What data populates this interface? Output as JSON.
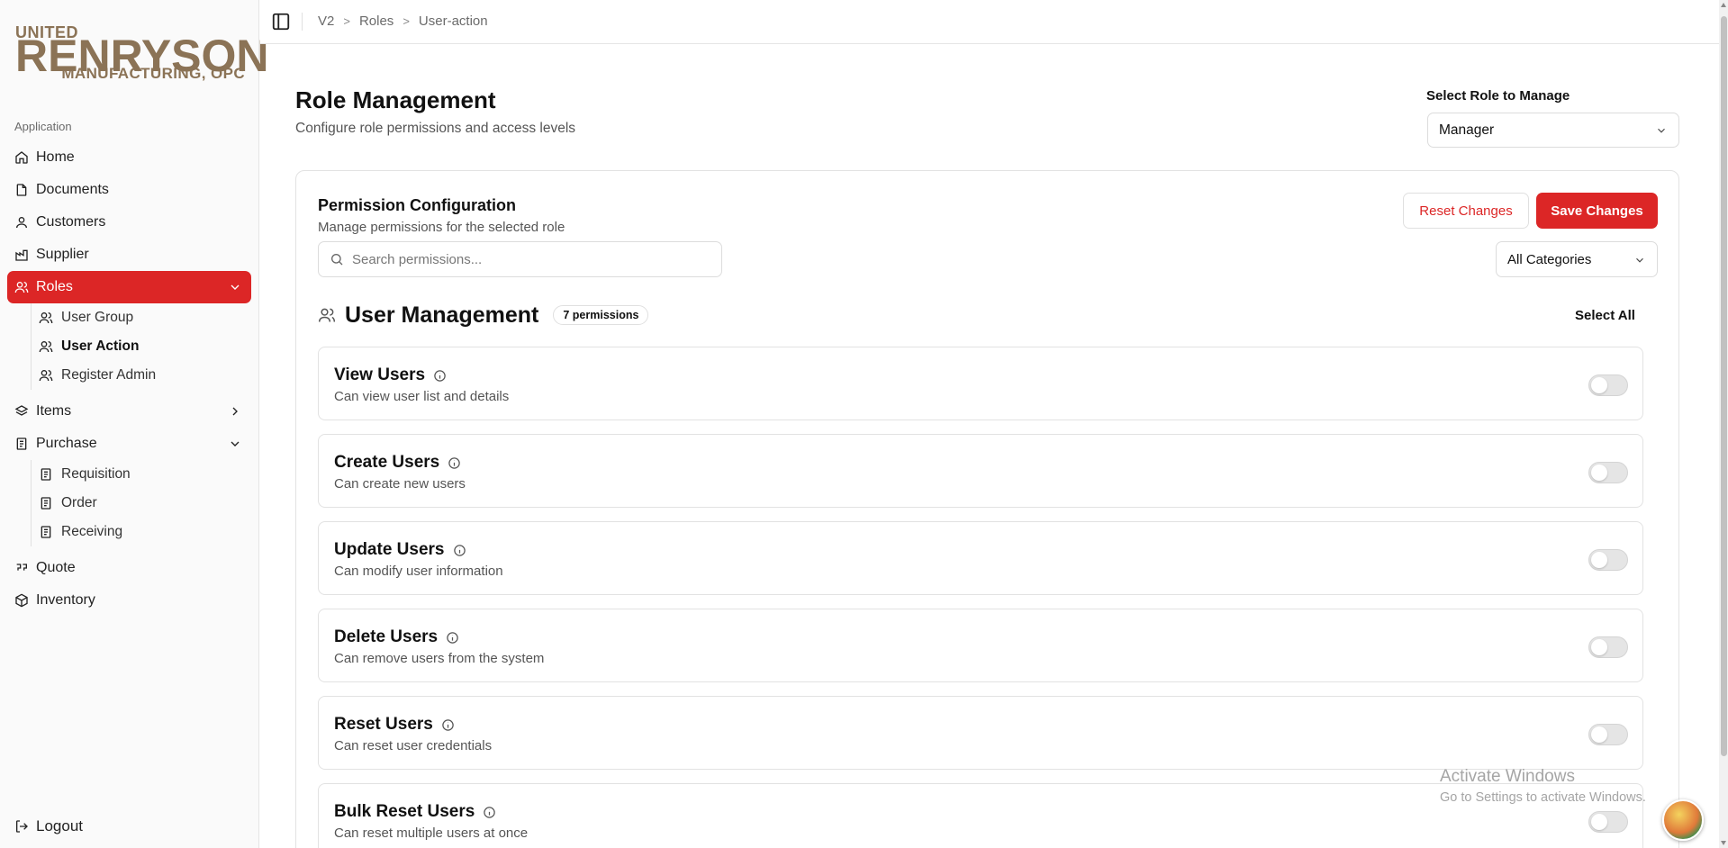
{
  "logo": {
    "line1": "UNITED",
    "line2": "RENRYSON",
    "line3": "MANUFACTURING, OPC",
    "color": "#8b7356"
  },
  "sidebar": {
    "section_label": "Application",
    "items": [
      {
        "label": "Home",
        "icon": "home-icon"
      },
      {
        "label": "Documents",
        "icon": "document-icon"
      },
      {
        "label": "Customers",
        "icon": "user-icon"
      },
      {
        "label": "Supplier",
        "icon": "factory-icon"
      },
      {
        "label": "Roles",
        "icon": "users-icon",
        "active": true,
        "expanded": true
      },
      {
        "label": "Items",
        "icon": "layers-icon"
      },
      {
        "label": "Purchase",
        "icon": "receipt-icon",
        "expanded": true
      },
      {
        "label": "Quote",
        "icon": "quote-icon"
      },
      {
        "label": "Inventory",
        "icon": "box-icon"
      }
    ],
    "roles_sub": [
      "User Group",
      "User Action",
      "Register Admin"
    ],
    "purchase_sub": [
      "Requisition",
      "Order",
      "Receiving"
    ],
    "logout": "Logout"
  },
  "breadcrumb": [
    "V2",
    "Roles",
    "User-action"
  ],
  "header": {
    "title": "Role Management",
    "subtitle": "Configure role permissions and access levels",
    "role_label": "Select Role to Manage",
    "role_value": "Manager"
  },
  "card": {
    "title": "Permission Configuration",
    "subtitle": "Manage permissions for the selected role",
    "reset_label": "Reset Changes",
    "save_label": "Save Changes",
    "search_placeholder": "Search permissions...",
    "category_value": "All Categories"
  },
  "group": {
    "title": "User Management",
    "count": "7 permissions",
    "select_all": "Select All"
  },
  "permissions": [
    {
      "name": "View Users",
      "desc": "Can view user list and details",
      "enabled": false
    },
    {
      "name": "Create Users",
      "desc": "Can create new users",
      "enabled": false
    },
    {
      "name": "Update Users",
      "desc": "Can modify user information",
      "enabled": false
    },
    {
      "name": "Delete Users",
      "desc": "Can remove users from the system",
      "enabled": false
    },
    {
      "name": "Reset Users",
      "desc": "Can reset user credentials",
      "enabled": false
    },
    {
      "name": "Bulk Reset Users",
      "desc": "Can reset multiple users at once",
      "enabled": false
    }
  ],
  "watermark": {
    "line1": "Activate Windows",
    "line2": "Go to Settings to activate Windows."
  },
  "colors": {
    "accent": "#dc2626"
  }
}
